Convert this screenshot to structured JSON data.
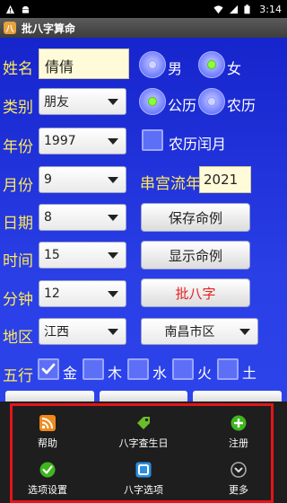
{
  "status_bar": {
    "time": "3:14"
  },
  "title_bar": {
    "title": "批八字算命",
    "app_icon_glyph": "八"
  },
  "form": {
    "name": {
      "label": "姓名",
      "value": "倩倩"
    },
    "gender": {
      "male": "男",
      "female": "女",
      "selected": "female"
    },
    "category": {
      "label": "类别",
      "value": "朋友"
    },
    "calendar": {
      "solar": "公历",
      "lunar": "农历",
      "selected": "solar"
    },
    "year": {
      "label": "年份",
      "value": "1997"
    },
    "leap_month": {
      "label": "农历闰月",
      "checked": false
    },
    "month": {
      "label": "月份",
      "value": "9"
    },
    "flow_year": {
      "label": "串宫流年",
      "value": "2021"
    },
    "day": {
      "label": "日期",
      "value": "8"
    },
    "hour": {
      "label": "时间",
      "value": "15"
    },
    "minute": {
      "label": "分钟",
      "value": "12"
    },
    "region": {
      "label": "地区",
      "province": "江西",
      "district": "南昌市区"
    },
    "five_elements": {
      "label": "五行",
      "items": [
        {
          "name": "金",
          "checked": true
        },
        {
          "name": "木",
          "checked": false
        },
        {
          "name": "水",
          "checked": false
        },
        {
          "name": "火",
          "checked": false
        },
        {
          "name": "土",
          "checked": false
        }
      ]
    }
  },
  "buttons": {
    "save": "保存命例",
    "show": "显示命例",
    "compute": "批八字"
  },
  "menu": {
    "items": [
      {
        "label": "帮助",
        "icon": "rss-icon"
      },
      {
        "label": "八字查生日",
        "icon": "tag-icon"
      },
      {
        "label": "注册",
        "icon": "plus-circle-icon"
      },
      {
        "label": "选项设置",
        "icon": "check-circle-icon"
      },
      {
        "label": "八字选项",
        "icon": "window-icon"
      },
      {
        "label": "更多",
        "icon": "chevron-down-circle-icon"
      }
    ]
  },
  "colors": {
    "background": "#2a3fe6",
    "label_yellow": "#ffe95a",
    "menu_bg": "#1e1e1e",
    "highlight_red": "#e4141b",
    "compute_red": "#e62020"
  }
}
